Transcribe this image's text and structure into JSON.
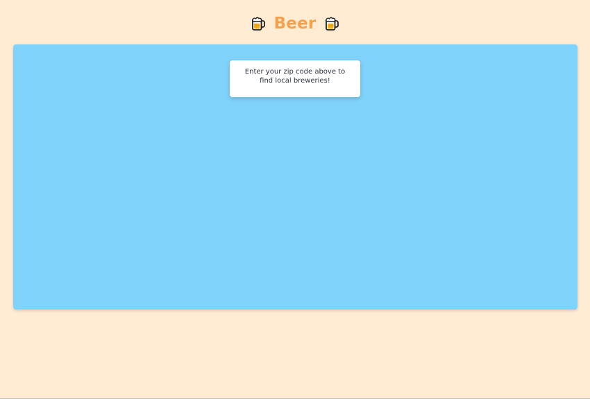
{
  "header": {
    "title": "Beer",
    "left_icon": "beer-mug-icon",
    "right_icon": "beer-mug-icon",
    "title_color": "#f7a04b"
  },
  "map": {
    "background_color": "#7fd2fa",
    "notice_text": "Enter your zip code above to find local breweries!"
  },
  "page": {
    "background_color": "#ffecd3"
  }
}
